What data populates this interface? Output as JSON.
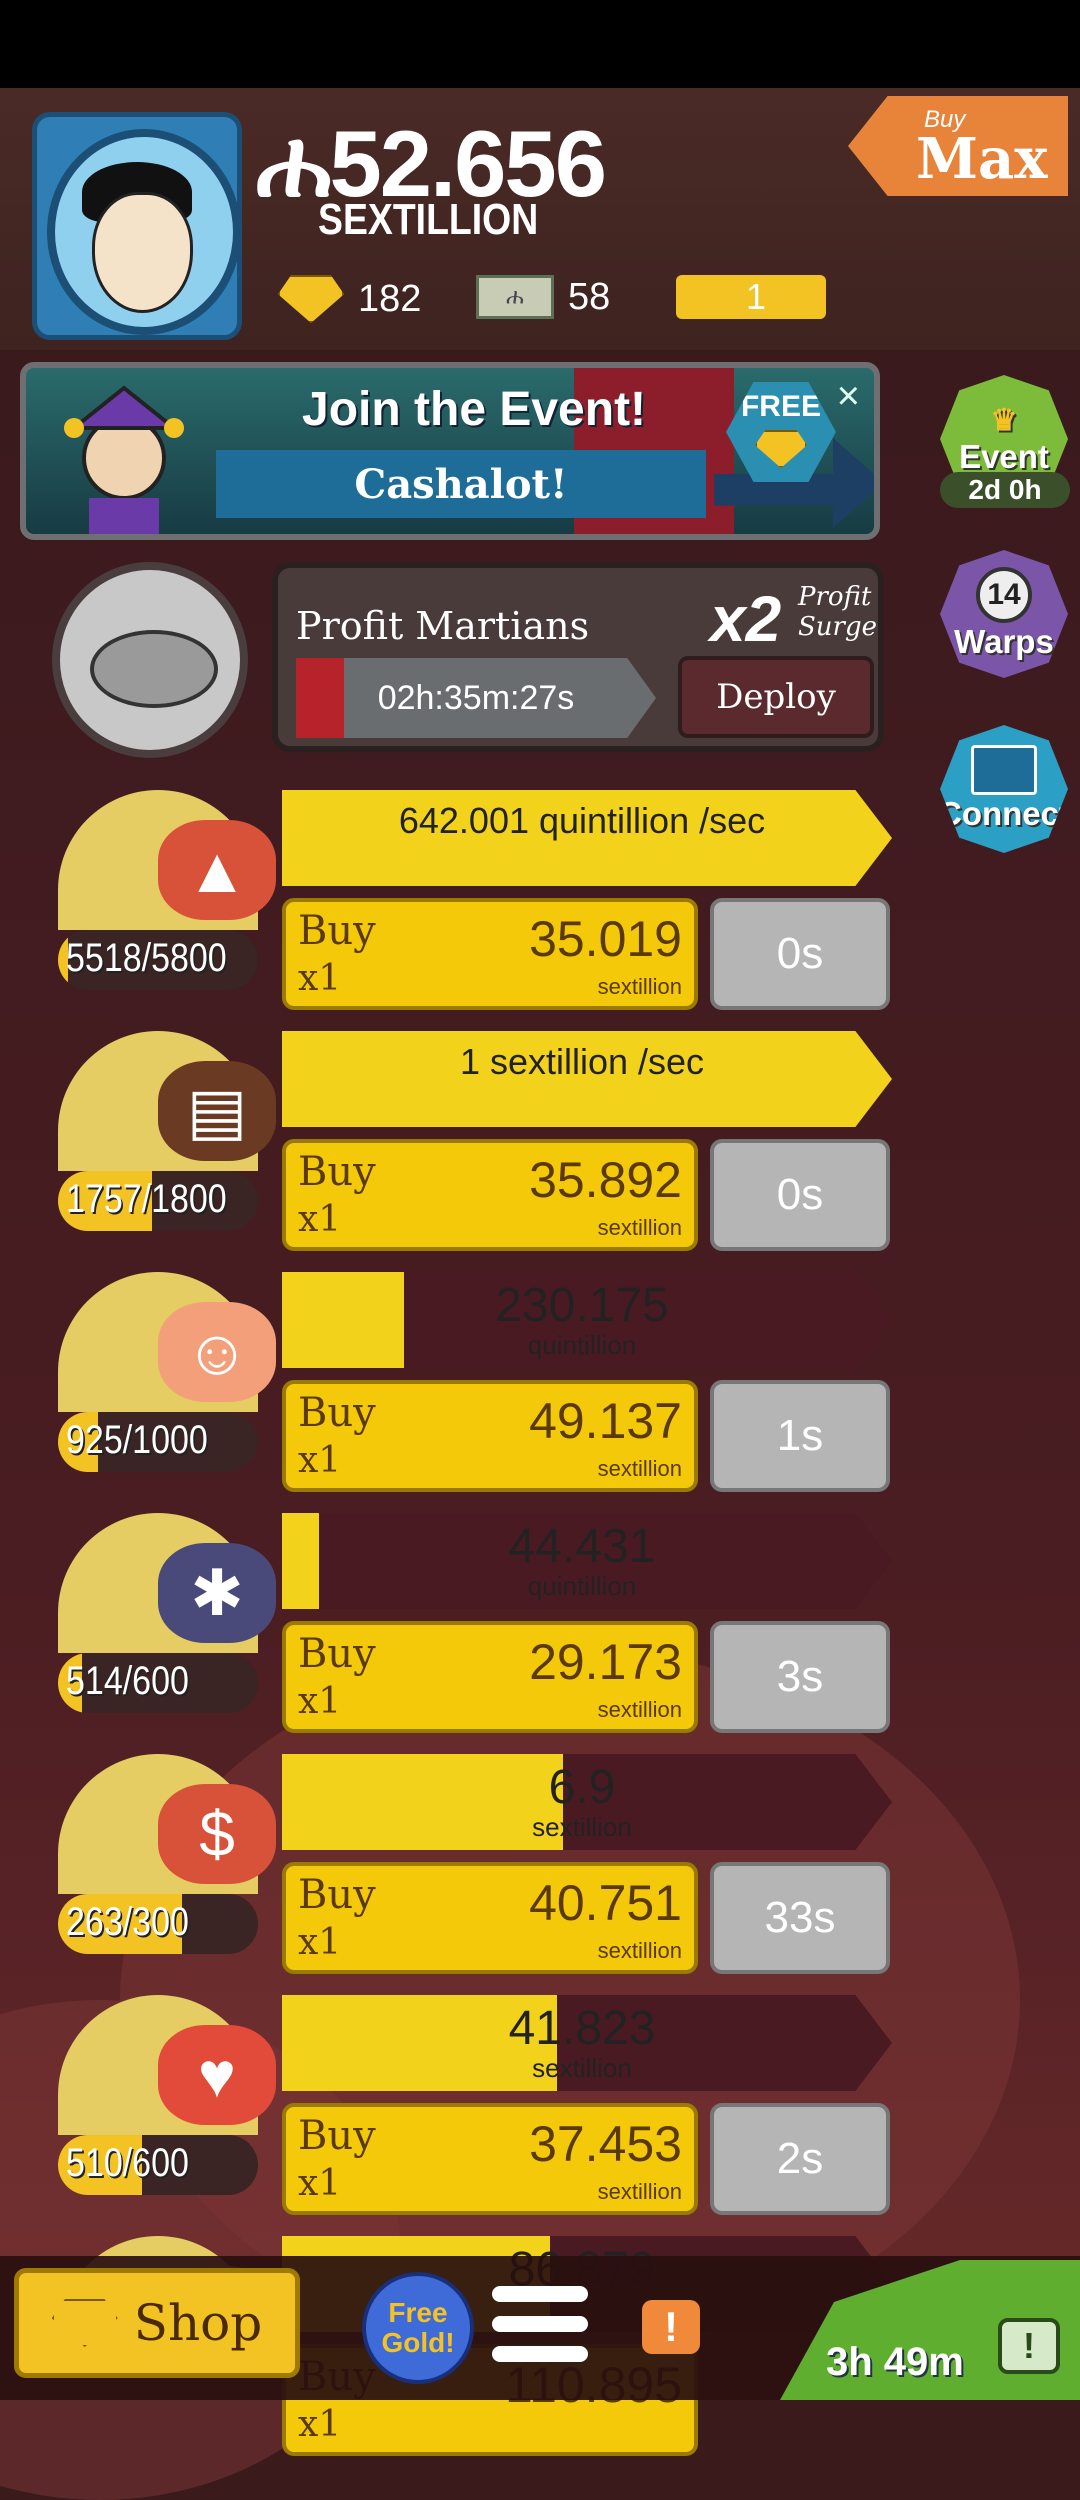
{
  "header": {
    "currency_symbol": "ሐ",
    "money": "52.656",
    "money_unit": "SEXTILLION",
    "gold_count": "182",
    "megabucks_count": "58",
    "ticket_count": "1",
    "buy_max": {
      "small": "Buy",
      "big": "Max"
    }
  },
  "event_banner": {
    "title": "Join the Event!",
    "subtitle": "Cashalot!",
    "free_badge": "FREE",
    "close": "×"
  },
  "side_buttons": {
    "event": {
      "label": "Event",
      "timer": "2d 0h"
    },
    "warps": {
      "count": "14",
      "label": "Warps"
    },
    "connect": {
      "label": "Connect"
    }
  },
  "manager": {
    "name": "Profit Martians",
    "multiplier": "x2",
    "surge_line1": "Profit",
    "surge_line2": "Surge",
    "timer": "02h:35m:27s",
    "deploy": "Deploy"
  },
  "businesses": [
    {
      "icon": "red-rocks-icon",
      "owned": "5518/5800",
      "owned_fraction": 0.05,
      "bar_text": "642.001 quintillion /sec",
      "bar_fill": 1.0,
      "bar_mode": "rate",
      "buy": "Buy",
      "qty": "x1",
      "cost": "35.019",
      "cost_unit": "sextillion",
      "time": "0s"
    },
    {
      "icon": "chocolate-bar-icon",
      "owned": "1757/1800",
      "owned_fraction": 0.47,
      "bar_text": "1 sextillion /sec",
      "bar_fill": 1.0,
      "bar_mode": "rate",
      "buy": "Buy",
      "qty": "x1",
      "cost": "35.892",
      "cost_unit": "sextillion",
      "time": "0s"
    },
    {
      "icon": "face-icon",
      "owned": "925/1000",
      "owned_fraction": 0.2,
      "bar_value": "230.175",
      "bar_unit": "quintillion",
      "bar_fill": 0.2,
      "bar_mode": "value",
      "buy": "Buy",
      "qty": "x1",
      "cost": "49.137",
      "cost_unit": "sextillion",
      "time": "1s"
    },
    {
      "icon": "space-bug-icon",
      "owned": "514/600",
      "owned_fraction": 0.12,
      "bar_value": "44.431",
      "bar_unit": "quintillion",
      "bar_fill": 0.06,
      "bar_mode": "value",
      "buy": "Buy",
      "qty": "x1",
      "cost": "29.173",
      "cost_unit": "sextillion",
      "time": "3s"
    },
    {
      "icon": "coin-seal-icon",
      "owned": "263/300",
      "owned_fraction": 0.62,
      "bar_value": "6.9",
      "bar_unit": "sextillion",
      "bar_fill": 0.46,
      "bar_mode": "value",
      "buy": "Buy",
      "qty": "x1",
      "cost": "40.751",
      "cost_unit": "sextillion",
      "time": "33s"
    },
    {
      "icon": "alien-robe-icon",
      "owned": "510/600",
      "owned_fraction": 0.42,
      "bar_value": "41.823",
      "bar_unit": "sextillion",
      "bar_fill": 0.45,
      "bar_mode": "value",
      "buy": "Buy",
      "qty": "x1",
      "cost": "37.453",
      "cost_unit": "sextillion",
      "time": "2s"
    },
    {
      "icon": "partial-icon",
      "owned": "",
      "owned_fraction": 0,
      "bar_value": "86.879",
      "bar_unit": "",
      "bar_fill": 0.44,
      "bar_mode": "value",
      "buy": "Buy",
      "qty": "x1",
      "cost": "110.895",
      "cost_unit": "",
      "time": ""
    }
  ],
  "bottom_bar": {
    "shop": "Shop",
    "free_gold_line1": "Free",
    "free_gold_line2": "Gold!",
    "alert": "!",
    "tv_timer": "3h 49m",
    "tv_icon": "!"
  },
  "colors": {
    "accent_yellow": "#f3c90a",
    "background": "#3b1a1c",
    "event_green": "#7dbb3a",
    "warp_purple": "#7b56a8",
    "connect_blue": "#2b9fc4"
  }
}
